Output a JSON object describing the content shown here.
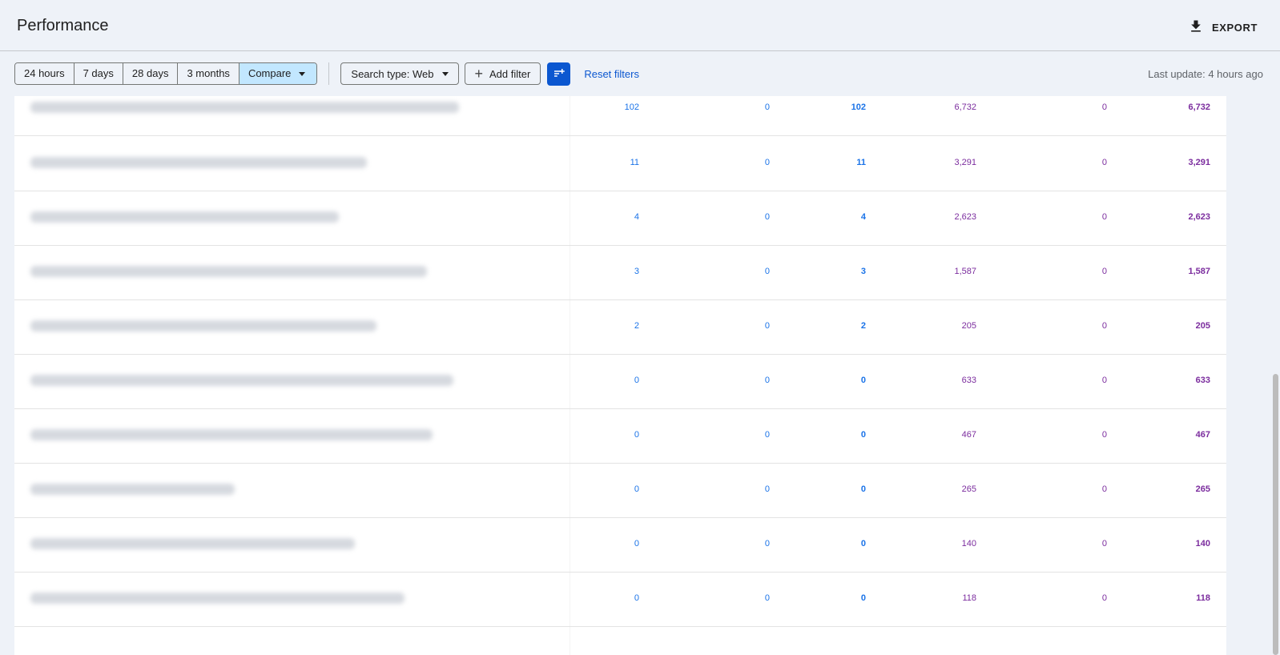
{
  "header": {
    "title": "Performance",
    "export_label": "EXPORT"
  },
  "toolbar": {
    "range_buttons": [
      "24 hours",
      "7 days",
      "28 days",
      "3 months"
    ],
    "compare_label": "Compare",
    "search_type_label": "Search type: Web",
    "add_filter_label": "Add filter",
    "reset_filters_label": "Reset filters",
    "last_update": "Last update: 4 hours ago"
  },
  "colors": {
    "blue_metric": "#1a73e8",
    "purple_metric": "#7b2c9e",
    "accent": "#0b57d0",
    "active_segment": "#c2e7ff"
  },
  "table": {
    "rows": [
      {
        "c1": "102",
        "c2": "0",
        "c3": "102",
        "c4": "6,732",
        "c5": "0",
        "c6": "6,732"
      },
      {
        "c1": "11",
        "c2": "0",
        "c3": "11",
        "c4": "3,291",
        "c5": "0",
        "c6": "3,291"
      },
      {
        "c1": "4",
        "c2": "0",
        "c3": "4",
        "c4": "2,623",
        "c5": "0",
        "c6": "2,623"
      },
      {
        "c1": "3",
        "c2": "0",
        "c3": "3",
        "c4": "1,587",
        "c5": "0",
        "c6": "1,587"
      },
      {
        "c1": "2",
        "c2": "0",
        "c3": "2",
        "c4": "205",
        "c5": "0",
        "c6": "205"
      },
      {
        "c1": "0",
        "c2": "0",
        "c3": "0",
        "c4": "633",
        "c5": "0",
        "c6": "633"
      },
      {
        "c1": "0",
        "c2": "0",
        "c3": "0",
        "c4": "467",
        "c5": "0",
        "c6": "467"
      },
      {
        "c1": "0",
        "c2": "0",
        "c3": "0",
        "c4": "265",
        "c5": "0",
        "c6": "265"
      },
      {
        "c1": "0",
        "c2": "0",
        "c3": "0",
        "c4": "140",
        "c5": "0",
        "c6": "140"
      },
      {
        "c1": "0",
        "c2": "0",
        "c3": "0",
        "c4": "118",
        "c5": "0",
        "c6": "118"
      }
    ]
  }
}
